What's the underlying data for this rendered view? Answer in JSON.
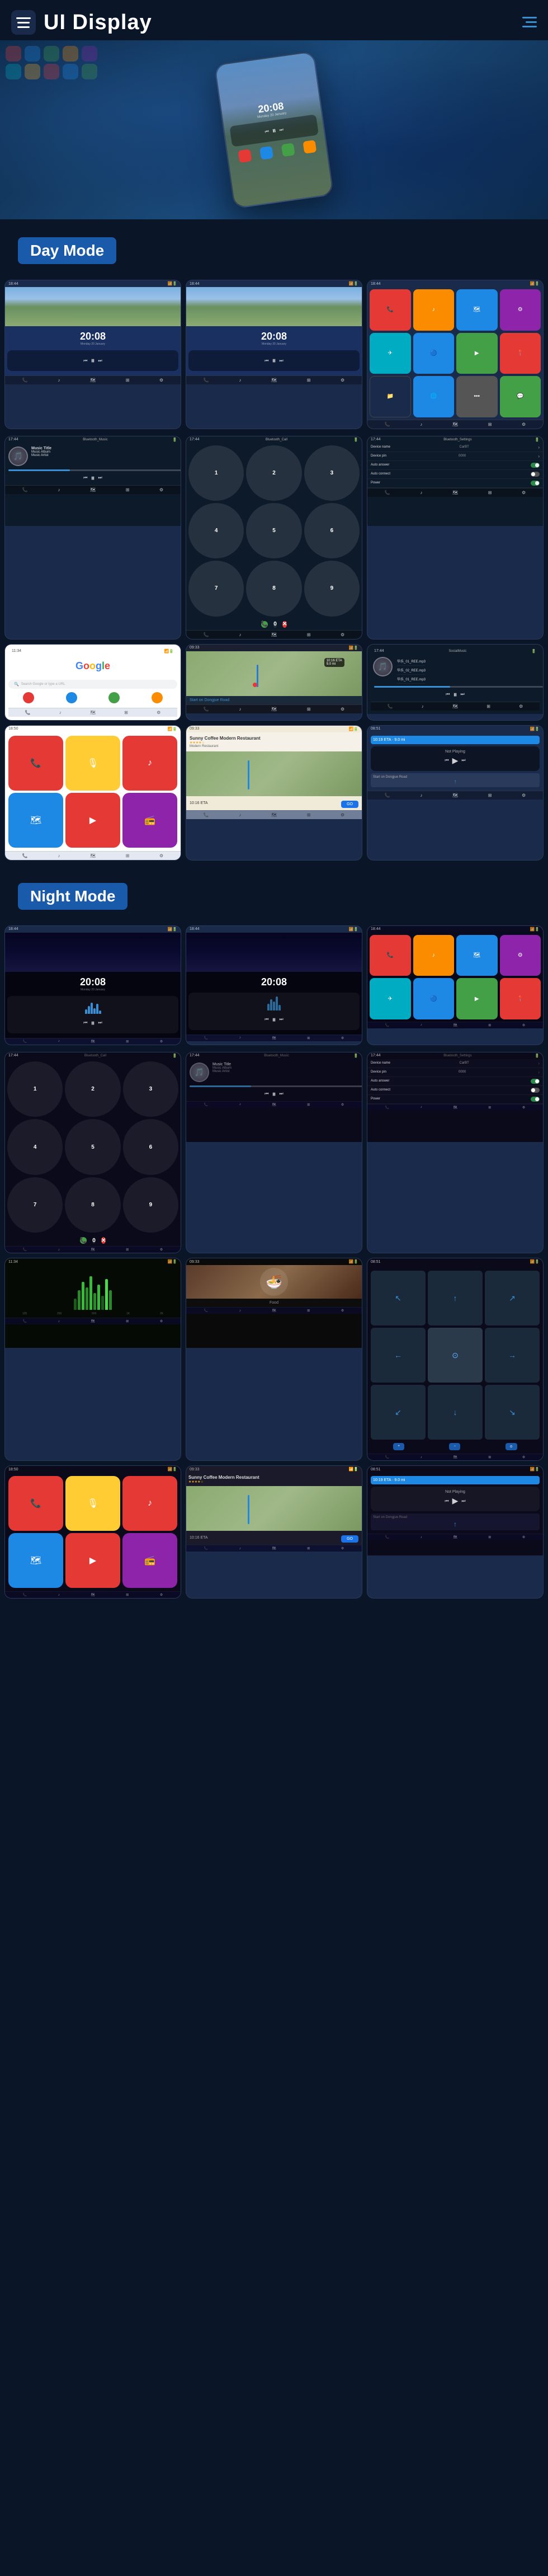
{
  "header": {
    "title": "UI Display",
    "menu_label": "menu",
    "nav_label": "navigation"
  },
  "sections": {
    "day_mode": "Day Mode",
    "night_mode": "Night Mode"
  },
  "clock": {
    "time": "20:08",
    "subtitle": "Monday 20 January"
  },
  "music": {
    "title": "Music Title",
    "album": "Music Album",
    "artist": "Music Artist"
  },
  "bluetooth": {
    "music_label": "Bluetooth_Music",
    "call_label": "Bluetooth_Call",
    "settings_label": "Bluetooth_Settings"
  },
  "settings": {
    "device_name_label": "Device name",
    "device_name_value": "CarBT",
    "device_pin_label": "Device pin",
    "device_pin_value": "0000",
    "auto_answer_label": "Auto answer",
    "auto_connect_label": "Auto connect",
    "power_label": "Power"
  },
  "navigation": {
    "coffee_name": "Sunny Coffee Modern Restaurant",
    "eta": "10:16 ETA",
    "distance": "9.0 mi",
    "go_label": "GO",
    "start_label": "Start on Dongjue Road",
    "not_playing": "Not Playing"
  },
  "social_music": {
    "label": "SocialMusic",
    "tracks": [
      "华乐_01_REE.mp3",
      "华乐_02_REE.mp3",
      "华乐_01_REE.mp3"
    ]
  },
  "google": {
    "search_placeholder": "Search Google or type a URL"
  },
  "colors": {
    "accent": "#3a8fd4",
    "day_label_bg": "#1a5aaa",
    "night_label_bg": "#1a5aaa",
    "app_red": "#e53935",
    "app_green": "#43a047",
    "app_blue": "#1e88e5",
    "app_orange": "#fb8c00",
    "app_purple": "#8e24aa",
    "app_teal": "#00acc1"
  }
}
